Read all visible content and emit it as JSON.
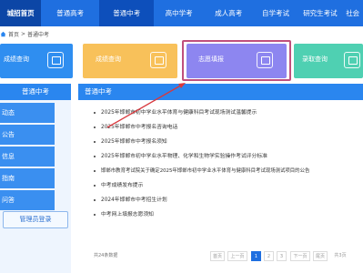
{
  "nav": {
    "items": [
      "城招首页",
      "普通高考",
      "普通中考",
      "高中学考",
      "成人高考",
      "自学考试",
      "研究生考试",
      "社会"
    ]
  },
  "breadcrumb": {
    "home": "首页",
    "sep": ">",
    "current": "普通中考"
  },
  "cards": [
    {
      "label": "成绩查询",
      "color": "#2f8ef0"
    },
    {
      "label": "成绩查询",
      "color": "#f8c15a"
    },
    {
      "label": "志愿填报",
      "color": "#8d86f0"
    },
    {
      "label": "录取查询",
      "color": "#4fd0b2"
    }
  ],
  "sidebar": {
    "title": "普通中考",
    "items": [
      "动态",
      "公告",
      "信息",
      "指南",
      "问答"
    ],
    "login": "管理员登录"
  },
  "main": {
    "title": "普通中考",
    "news": [
      "2025年邯郸市初中学业水平体育与健康科目考试现场测试温馨提示",
      "2025年邯郸市中考报名咨询电话",
      "2025年邯郸市中考报名须知",
      "2025年邯郸市初中学业水平物理、化学和生物学实验操作考试评分标准",
      "邯郸市教育考试院关于确定2025年邯郸市初中学业水平体育与健康科目考试现场测试项目的公告",
      "中考成绩发布提示",
      "2024年邯郸市中考招生计划",
      "中考网上填报志愿须知"
    ]
  },
  "pager": {
    "count": "共24条数据",
    "first": "首页",
    "prev": "上一页",
    "pages": [
      "1",
      "2",
      "3"
    ],
    "next": "下一页",
    "last": "尾页",
    "total": "共3页"
  },
  "colors": {
    "nav": "#1f6fe0",
    "arrow": "#d8383d",
    "highlight": "#c0507d"
  }
}
